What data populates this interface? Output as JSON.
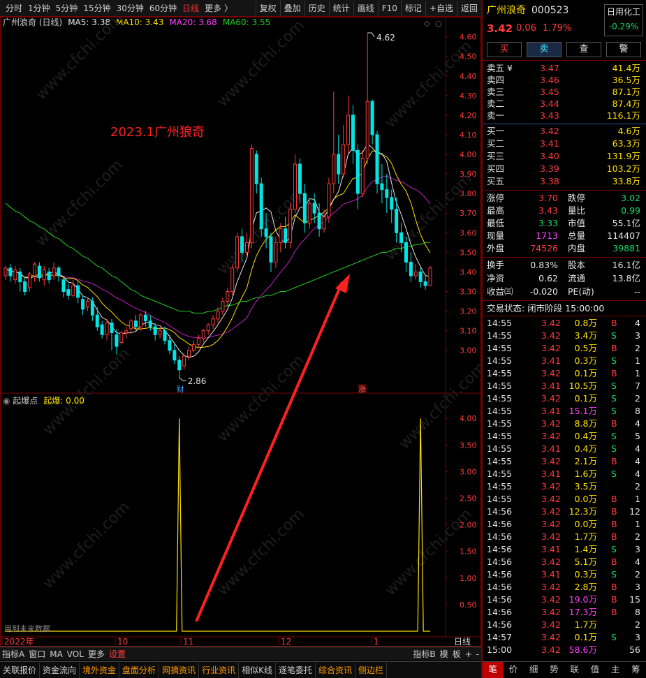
{
  "toolbar": {
    "periods": [
      "分时",
      "1分钟",
      "5分钟",
      "15分钟",
      "30分钟",
      "60分钟",
      "日线",
      "更多 〉"
    ],
    "active_period": "日线",
    "tools": [
      "复权",
      "叠加",
      "历史",
      "统计",
      "画线",
      "F10",
      "标记",
      "+自选",
      "返回"
    ]
  },
  "main_header": {
    "name": "广州浪奇 (日线)",
    "ma": [
      {
        "label": "MA5: 3.38",
        "color": "#e6e6e6"
      },
      {
        "label": "MA10: 3.43",
        "color": "#ffe000"
      },
      {
        "label": "MA20: 3.68",
        "color": "#ff40ff"
      },
      {
        "label": "MA60: 3.55",
        "color": "#20d020"
      }
    ]
  },
  "annotation": "2023.1广州狼奇",
  "sub_header": {
    "name": "起爆点",
    "value_label": "起爆: 0.00"
  },
  "watermark": "www.cfchi.com",
  "future_note": "用到未来数据",
  "markers": {
    "high": "4.62",
    "low": "2.86",
    "event1": "财",
    "event2": "涨"
  },
  "chart_data": {
    "type": "candlestick",
    "price_ylim": [
      2.86,
      4.62
    ],
    "price_ticks": [
      "4.60",
      "4.50",
      "4.40",
      "4.30",
      "4.20",
      "4.10",
      "4.00",
      "3.90",
      "3.80",
      "3.70",
      "3.60",
      "3.50",
      "3.40",
      "3.30",
      "3.20",
      "3.10",
      "3.00"
    ],
    "indicator_ticks": [
      "4.00",
      "3.50",
      "3.00",
      "2.50",
      "2.00",
      "1.50",
      "1.00",
      "0.50"
    ],
    "x_labels": [
      "2022年",
      "10",
      "11",
      "12",
      "1"
    ],
    "x_unit": "日线",
    "candles": [
      [
        3.38,
        3.42,
        3.43,
        3.36
      ],
      [
        3.42,
        3.38,
        3.44,
        3.35
      ],
      [
        3.36,
        3.41,
        3.43,
        3.34
      ],
      [
        3.4,
        3.35,
        3.42,
        3.3
      ],
      [
        3.35,
        3.3,
        3.37,
        3.28
      ],
      [
        3.32,
        3.39,
        3.4,
        3.3
      ],
      [
        3.38,
        3.44,
        3.45,
        3.35
      ],
      [
        3.43,
        3.37,
        3.45,
        3.35
      ],
      [
        3.36,
        3.41,
        3.43,
        3.33
      ],
      [
        3.4,
        3.36,
        3.42,
        3.34
      ],
      [
        3.38,
        3.42,
        3.45,
        3.36
      ],
      [
        3.42,
        3.38,
        3.43,
        3.35
      ],
      [
        3.36,
        3.3,
        3.38,
        3.27
      ],
      [
        3.31,
        3.28,
        3.34,
        3.26
      ],
      [
        3.28,
        3.33,
        3.36,
        3.27
      ],
      [
        3.33,
        3.27,
        3.35,
        3.24
      ],
      [
        3.26,
        3.21,
        3.28,
        3.18
      ],
      [
        3.22,
        3.25,
        3.27,
        3.2
      ],
      [
        3.25,
        3.18,
        3.27,
        3.15
      ],
      [
        3.18,
        3.12,
        3.22,
        3.1
      ],
      [
        3.13,
        3.08,
        3.15,
        3.06
      ],
      [
        3.08,
        3.14,
        3.16,
        3.05
      ],
      [
        3.14,
        3.09,
        3.16,
        3.0
      ],
      [
        3.08,
        3.02,
        3.11,
        2.98
      ],
      [
        3.04,
        3.09,
        3.1,
        3.03
      ],
      [
        3.09,
        3.1,
        3.12,
        3.06
      ],
      [
        3.11,
        3.15,
        3.16,
        3.08
      ],
      [
        3.15,
        3.12,
        3.18,
        3.1
      ],
      [
        3.12,
        3.18,
        3.19,
        3.1
      ],
      [
        3.18,
        3.15,
        3.2,
        3.12
      ],
      [
        3.15,
        3.12,
        3.18,
        3.1
      ],
      [
        3.12,
        3.08,
        3.14,
        3.05
      ],
      [
        3.08,
        3.1,
        3.12,
        3.06
      ],
      [
        3.1,
        3.05,
        3.12,
        3.03
      ],
      [
        3.05,
        3.0,
        3.08,
        2.98
      ],
      [
        3.0,
        2.95,
        3.03,
        2.93
      ],
      [
        2.95,
        2.9,
        2.97,
        2.86
      ],
      [
        2.92,
        2.97,
        2.98,
        2.9
      ],
      [
        2.97,
        3.0,
        3.02,
        2.95
      ],
      [
        3.0,
        3.03,
        3.05,
        2.99
      ],
      [
        3.03,
        3.06,
        3.08,
        3.01
      ],
      [
        3.06,
        3.1,
        3.11,
        3.04
      ],
      [
        3.1,
        3.13,
        3.14,
        3.08
      ],
      [
        3.13,
        3.16,
        3.18,
        3.11
      ],
      [
        3.16,
        3.2,
        3.22,
        3.14
      ],
      [
        3.2,
        3.25,
        3.27,
        3.18
      ],
      [
        3.25,
        3.3,
        3.32,
        3.22
      ],
      [
        3.3,
        3.42,
        3.44,
        3.28
      ],
      [
        3.42,
        3.58,
        3.6,
        3.4
      ],
      [
        3.58,
        3.5,
        3.62,
        3.45
      ],
      [
        3.5,
        3.55,
        3.6,
        3.48
      ],
      [
        3.55,
        4.03,
        4.05,
        3.52
      ],
      [
        4.0,
        3.85,
        4.02,
        3.8
      ],
      [
        3.85,
        3.62,
        3.88,
        3.58
      ],
      [
        3.62,
        3.58,
        3.7,
        3.52
      ],
      [
        3.58,
        3.45,
        3.6,
        3.4
      ],
      [
        3.45,
        3.55,
        3.58,
        3.42
      ],
      [
        3.55,
        3.62,
        3.65,
        3.5
      ],
      [
        3.62,
        3.55,
        3.68,
        3.52
      ],
      [
        3.55,
        3.72,
        3.75,
        3.52
      ],
      [
        3.72,
        3.95,
        4.0,
        3.7
      ],
      [
        3.95,
        3.8,
        3.98,
        3.75
      ],
      [
        3.8,
        3.65,
        3.85,
        3.6
      ],
      [
        3.65,
        3.75,
        3.78,
        3.62
      ],
      [
        3.75,
        3.7,
        3.8,
        3.65
      ],
      [
        3.7,
        3.62,
        3.75,
        3.58
      ],
      [
        3.62,
        3.68,
        3.72,
        3.6
      ],
      [
        3.68,
        3.85,
        3.88,
        3.65
      ],
      [
        3.85,
        4.0,
        4.32,
        3.8
      ],
      [
        4.0,
        3.9,
        4.1,
        3.85
      ],
      [
        3.9,
        4.05,
        4.15,
        3.88
      ],
      [
        4.05,
        4.2,
        4.3,
        4.0
      ],
      [
        4.2,
        4.02,
        4.25,
        3.95
      ],
      [
        4.02,
        3.8,
        4.05,
        3.72
      ],
      [
        3.8,
        3.98,
        4.02,
        3.78
      ],
      [
        3.98,
        4.27,
        4.62,
        3.95
      ],
      [
        4.27,
        4.1,
        4.28,
        4.05
      ],
      [
        4.1,
        3.85,
        4.12,
        3.8
      ],
      [
        3.85,
        3.82,
        3.95,
        3.75
      ],
      [
        3.82,
        3.78,
        3.9,
        3.7
      ],
      [
        3.78,
        3.72,
        3.82,
        3.65
      ],
      [
        3.72,
        3.6,
        3.78,
        3.55
      ],
      [
        3.6,
        3.55,
        3.65,
        3.5
      ],
      [
        3.55,
        3.45,
        3.58,
        3.4
      ],
      [
        3.45,
        3.38,
        3.5,
        3.35
      ],
      [
        3.38,
        3.4,
        3.44,
        3.36
      ],
      [
        3.4,
        3.35,
        3.42,
        3.32
      ],
      [
        3.35,
        3.33,
        3.38,
        3.31
      ],
      [
        3.33,
        3.42,
        3.43,
        3.33
      ]
    ],
    "ma60": [
      3.75,
      3.73,
      3.71,
      3.7,
      3.68,
      3.66,
      3.65,
      3.63,
      3.62,
      3.6,
      3.58,
      3.57,
      3.55,
      3.53,
      3.52,
      3.5,
      3.48,
      3.47,
      3.45,
      3.43,
      3.42,
      3.4,
      3.38,
      3.37,
      3.35,
      3.33,
      3.31,
      3.3,
      3.28,
      3.27,
      3.26,
      3.25,
      3.24,
      3.23,
      3.22,
      3.21,
      3.2,
      3.2,
      3.2,
      3.19,
      3.19,
      3.19,
      3.2,
      3.2,
      3.21,
      3.22,
      3.23,
      3.23,
      3.24,
      3.25,
      3.25,
      3.26,
      3.27,
      3.27,
      3.28,
      3.28,
      3.29,
      3.3,
      3.3,
      3.31,
      3.32,
      3.33,
      3.34,
      3.35,
      3.36,
      3.37,
      3.38,
      3.39,
      3.4,
      3.41,
      3.42,
      3.43,
      3.44,
      3.45,
      3.46,
      3.47,
      3.48,
      3.49,
      3.5,
      3.5,
      3.51,
      3.52,
      3.52,
      3.53,
      3.53,
      3.54,
      3.54,
      3.55,
      3.55
    ],
    "indicator_peaks": [
      {
        "index": 36,
        "value": 4.0
      },
      {
        "index": 86,
        "value": 4.0
      }
    ],
    "indicator_ylim": [
      0,
      4.2
    ]
  },
  "stock": {
    "name": "广州浪奇",
    "code": "000523",
    "sector": "日用化工",
    "sector_change": "-0.29%",
    "price": "3.42",
    "change": "0.06",
    "pct": "1.79%"
  },
  "buttons": [
    "买",
    "卖",
    "查",
    "警"
  ],
  "asks": [
    {
      "label": "卖五 ¥",
      "price": "3.47",
      "vol": "41.4万"
    },
    {
      "label": "卖四",
      "price": "3.46",
      "vol": "36.5万"
    },
    {
      "label": "卖三",
      "price": "3.45",
      "vol": "87.1万"
    },
    {
      "label": "卖二",
      "price": "3.44",
      "vol": "87.4万"
    },
    {
      "label": "卖一",
      "price": "3.43",
      "vol": "116.1万"
    }
  ],
  "bids": [
    {
      "label": "买一",
      "price": "3.42",
      "vol": "4.6万"
    },
    {
      "label": "买二",
      "price": "3.41",
      "vol": "63.3万"
    },
    {
      "label": "买三",
      "price": "3.40",
      "vol": "131.9万"
    },
    {
      "label": "买四",
      "price": "3.39",
      "vol": "103.2万"
    },
    {
      "label": "买五",
      "price": "3.38",
      "vol": "33.8万"
    }
  ],
  "stats1": [
    {
      "l1": "涨停",
      "v1": "3.70",
      "c1": "red",
      "l2": "跌停",
      "v2": "3.02",
      "c2": "grn"
    },
    {
      "l1": "最高",
      "v1": "3.43",
      "c1": "red",
      "l2": "量比",
      "v2": "0.99",
      "c2": "grn"
    },
    {
      "l1": "最低",
      "v1": "3.33",
      "c1": "grn",
      "l2": "市值",
      "v2": "55.1亿",
      "c2": "wht"
    },
    {
      "l1": "现量",
      "v1": "1713",
      "c1": "mag",
      "l2": "总量",
      "v2": "114407",
      "c2": "wht"
    },
    {
      "l1": "外盘",
      "v1": "74526",
      "c1": "red",
      "l2": "内盘",
      "v2": "39881",
      "c2": "grn"
    }
  ],
  "stats2": [
    {
      "l1": "换手",
      "v1": "0.83%",
      "l2": "股本",
      "v2": "16.1亿"
    },
    {
      "l1": "净资",
      "v1": "0.62",
      "l2": "流通",
      "v2": "13.8亿"
    },
    {
      "l1": "收益㈢",
      "v1": "-0.020",
      "l2": "PE(动)",
      "v2": "--"
    }
  ],
  "trade_status": "交易状态: 闭市阶段 15:00:00",
  "ticks": [
    [
      "14:55",
      "3.42",
      "0.8万",
      "B",
      "4"
    ],
    [
      "14:55",
      "3.42",
      "3.4万",
      "S",
      "3"
    ],
    [
      "14:55",
      "3.42",
      "0.5万",
      "B",
      "2"
    ],
    [
      "14:55",
      "3.41",
      "0.3万",
      "S",
      "1"
    ],
    [
      "14:55",
      "3.42",
      "0.1万",
      "B",
      "1"
    ],
    [
      "14:55",
      "3.41",
      "10.5万",
      "S",
      "7"
    ],
    [
      "14:55",
      "3.42",
      "0.1万",
      "S",
      "2"
    ],
    [
      "14:55",
      "3.41",
      "15.1万",
      "S",
      "8"
    ],
    [
      "14:55",
      "3.42",
      "8.8万",
      "B",
      "4"
    ],
    [
      "14:55",
      "3.42",
      "0.4万",
      "S",
      "5"
    ],
    [
      "14:55",
      "3.41",
      "0.4万",
      "S",
      "4"
    ],
    [
      "14:55",
      "3.42",
      "2.1万",
      "B",
      "4"
    ],
    [
      "14:55",
      "3.41",
      "1.6万",
      "S",
      "4"
    ],
    [
      "14:55",
      "3.42",
      "3.5万",
      "",
      "2"
    ],
    [
      "14:55",
      "3.42",
      "0.0万",
      "B",
      "1"
    ],
    [
      "14:56",
      "3.42",
      "12.3万",
      "B",
      "12"
    ],
    [
      "14:56",
      "3.42",
      "0.0万",
      "B",
      "1"
    ],
    [
      "14:56",
      "3.42",
      "1.7万",
      "B",
      "2"
    ],
    [
      "14:56",
      "3.41",
      "1.4万",
      "S",
      "3"
    ],
    [
      "14:56",
      "3.42",
      "5.1万",
      "B",
      "4"
    ],
    [
      "14:56",
      "3.41",
      "0.3万",
      "S",
      "2"
    ],
    [
      "14:56",
      "3.42",
      "2.8万",
      "B",
      "3"
    ],
    [
      "14:56",
      "3.42",
      "19.0万",
      "B",
      "15"
    ],
    [
      "14:56",
      "3.42",
      "17.3万",
      "B",
      "8"
    ],
    [
      "14:56",
      "3.42",
      "1.7万",
      "",
      "2"
    ],
    [
      "14:57",
      "3.42",
      "0.1万",
      "S",
      "3"
    ],
    [
      "15:00",
      "3.42",
      "58.6万",
      "",
      "56"
    ]
  ],
  "bottom1": [
    "指标A",
    "窗口",
    "MA",
    "VOL",
    "更多",
    "设置",
    "指标B",
    "模",
    "板",
    "+",
    "-"
  ],
  "bottom2": [
    "关联报价",
    "资金流向",
    "境外资金",
    "盘面分析",
    "网摘资讯",
    "行业资讯",
    "相似K线",
    "逐笔委托",
    "综合资讯",
    "侧边栏"
  ],
  "side_tabs": [
    "笔",
    "价",
    "细",
    "势",
    "联",
    "值",
    "主",
    "筹"
  ],
  "side_tab_active": "笔"
}
